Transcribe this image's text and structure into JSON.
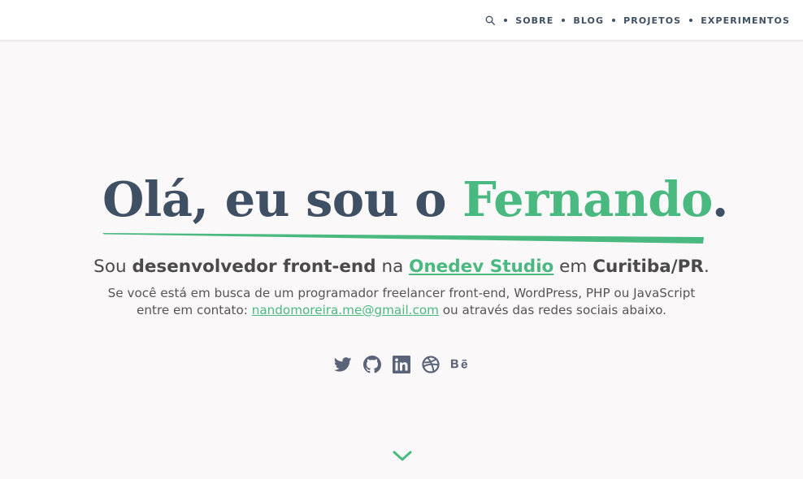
{
  "nav": {
    "items": [
      {
        "label": "SOBRE"
      },
      {
        "label": "BLOG"
      },
      {
        "label": "PROJETOS"
      },
      {
        "label": "EXPERIMENTOS"
      }
    ],
    "search_icon": "search-icon"
  },
  "hero": {
    "title_prefix": "Olá, eu sou o ",
    "title_name": "Fernando",
    "title_suffix": ".",
    "subtitle": {
      "part1": "Sou ",
      "role": "desenvolvedor front-end",
      "part2": " na ",
      "company": "Onedev Studio",
      "part3": " em ",
      "city": "Curitiba/PR",
      "part4": "."
    },
    "description": {
      "line1": "Se você está em busca de um programador freelancer front-end, WordPress, PHP ou JavaScript",
      "line2_prefix": "entre em contato: ",
      "email": "nandomoreira.me@gmail.com",
      "line2_suffix": " ou através das redes sociais abaixo."
    }
  },
  "social": [
    "twitter-icon",
    "github-icon",
    "linkedin-icon",
    "dribbble-icon",
    "behance-icon"
  ],
  "scroll_icon": "chevron-down-icon",
  "colors": {
    "accent": "#4ab980",
    "text_dark": "#3f4f64",
    "icon": "#5a6478",
    "background": "#faf8f9",
    "header_bg": "#ffffff"
  }
}
